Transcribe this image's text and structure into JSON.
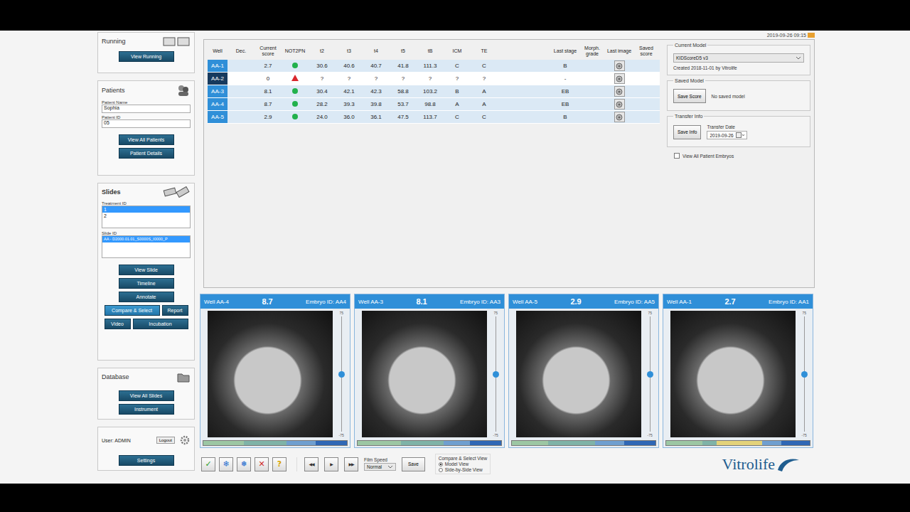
{
  "app": {
    "datetime": "2019-09-26 09:15"
  },
  "sidebar": {
    "running": {
      "title": "Running",
      "buttons": [
        {
          "label": "View Running"
        }
      ]
    },
    "patients": {
      "title": "Patients",
      "fields": [
        {
          "label": "Patient Name",
          "value": "Sophia"
        },
        {
          "label": "Patient ID",
          "value": "05"
        }
      ],
      "buttons": [
        {
          "label": "View All Patients"
        },
        {
          "label": "Patient Details"
        }
      ]
    },
    "slides": {
      "title": "Slides",
      "treatment_label": "Treatment ID",
      "treatments": [
        {
          "label": "1",
          "selected": true
        },
        {
          "label": "2",
          "selected": false
        }
      ],
      "slide_label": "Slide ID",
      "slides": [
        {
          "label": "AA - D2000.01.01_S0000S_I0000_P",
          "selected": true
        }
      ],
      "buttons": [
        {
          "label": "View Slide",
          "kind": "full",
          "selected": false
        },
        {
          "label": "Timeline",
          "kind": "full",
          "selected": false
        },
        {
          "label": "Annotate",
          "kind": "full",
          "selected": false
        },
        {
          "label": "Compare & Select",
          "kind": "full",
          "selected": true
        },
        {
          "label": "Report",
          "kind": "half",
          "selected": false
        },
        {
          "label": "Video",
          "kind": "half",
          "selected": false
        },
        {
          "label": "Incubation",
          "kind": "full",
          "selected": false
        }
      ]
    },
    "database": {
      "title": "Database",
      "buttons": [
        {
          "label": "View All Slides"
        },
        {
          "label": "Instrument"
        }
      ]
    },
    "user": {
      "label": "User: ADMIN",
      "logout": "Logout",
      "settings": "Settings"
    }
  },
  "table": {
    "columns": [
      "Well",
      "Dec.",
      "Current score",
      "NOT2PN",
      "t2",
      "t3",
      "t4",
      "t5",
      "tB",
      "ICM",
      "TE",
      "",
      "",
      "Last stage",
      "Morph. grade",
      "Last image",
      "Saved score"
    ],
    "rows": [
      {
        "well": "AA-1",
        "selected": false,
        "highlighted": true,
        "dec": "",
        "score": "2.7",
        "not2pn": {
          "kind": "dot",
          "color": "#22b14c"
        },
        "values": [
          "30.6",
          "40.6",
          "40.7",
          "41.8",
          "111.3",
          "C",
          "C",
          "",
          ""
        ],
        "last_stage": "B",
        "morph": "",
        "has_image": true,
        "saved": ""
      },
      {
        "well": "AA-2",
        "selected": true,
        "highlighted": false,
        "dec": "",
        "score": "0",
        "not2pn": {
          "kind": "triangle",
          "color": "#d9262c"
        },
        "values": [
          "?",
          "?",
          "?",
          "?",
          "?",
          "?",
          "?",
          "",
          ""
        ],
        "last_stage": "-",
        "morph": "",
        "has_image": true,
        "saved": ""
      },
      {
        "well": "AA-3",
        "selected": false,
        "highlighted": true,
        "dec": "",
        "score": "8.1",
        "not2pn": {
          "kind": "dot",
          "color": "#22b14c"
        },
        "values": [
          "30.4",
          "42.1",
          "42.3",
          "58.8",
          "103.2",
          "B",
          "A",
          "",
          ""
        ],
        "last_stage": "EB",
        "morph": "",
        "has_image": true,
        "saved": ""
      },
      {
        "well": "AA-4",
        "selected": false,
        "highlighted": true,
        "dec": "",
        "score": "8.7",
        "not2pn": {
          "kind": "dot",
          "color": "#22b14c"
        },
        "values": [
          "28.2",
          "39.3",
          "39.8",
          "53.7",
          "98.8",
          "A",
          "A",
          "",
          ""
        ],
        "last_stage": "EB",
        "morph": "",
        "has_image": true,
        "saved": ""
      },
      {
        "well": "AA-5",
        "selected": false,
        "highlighted": true,
        "dec": "",
        "score": "2.9",
        "not2pn": {
          "kind": "dot",
          "color": "#22b14c"
        },
        "values": [
          "24.0",
          "36.0",
          "36.1",
          "47.5",
          "113.7",
          "C",
          "C",
          "",
          ""
        ],
        "last_stage": "B",
        "morph": "",
        "has_image": true,
        "saved": ""
      }
    ]
  },
  "right_panel": {
    "current_model": {
      "title": "Current Model",
      "value": "KIDScoreD5 v3",
      "created": "Created 2018-11-01 by Vitrolife"
    },
    "saved_model": {
      "title": "Saved Model",
      "button": "Save Score",
      "status": "No saved model"
    },
    "transfer": {
      "title": "Transfer Info",
      "button": "Save Info",
      "date_label": "Transfer Date",
      "date": "2019-09-26"
    },
    "view_all": {
      "label": "View All Patient Embryos",
      "checked": false
    }
  },
  "cards": [
    {
      "well": "Well AA-4",
      "score": "8.7",
      "embryo": "Embryo ID: AA4",
      "focus_max": "75",
      "focus_min": "-75",
      "focus": 0.5,
      "timeline": [
        {
          "color": "#9cc7a4",
          "level": 0.28
        },
        {
          "color": "#7fb3a8",
          "level": 0.3
        },
        {
          "color": "#6f9fd0",
          "level": 0.2
        },
        {
          "color": "#2f67b5",
          "level": 0.22
        }
      ]
    },
    {
      "well": "Well AA-3",
      "score": "8.1",
      "embryo": "Embryo ID: AA3",
      "focus_max": "75",
      "focus_min": "-75",
      "focus": 0.5,
      "timeline": [
        {
          "color": "#9cc7a4",
          "level": 0.3
        },
        {
          "color": "#7fb3a8",
          "level": 0.3
        },
        {
          "color": "#6f9fd0",
          "level": 0.18
        },
        {
          "color": "#2f67b5",
          "level": 0.22
        }
      ]
    },
    {
      "well": "Well AA-5",
      "score": "2.9",
      "embryo": "Embryo ID: AA5",
      "focus_max": "75",
      "focus_min": "-75",
      "focus": 0.5,
      "timeline": [
        {
          "color": "#9cc7a4",
          "level": 0.25
        },
        {
          "color": "#7fb3a8",
          "level": 0.33
        },
        {
          "color": "#6f9fd0",
          "level": 0.2
        },
        {
          "color": "#2f67b5",
          "level": 0.22
        }
      ]
    },
    {
      "well": "Well AA-1",
      "score": "2.7",
      "embryo": "Embryo ID: AA1",
      "focus_max": "75",
      "focus_min": "-75",
      "focus": 0.5,
      "timeline": [
        {
          "color": "#9cc7a4",
          "level": 0.25
        },
        {
          "color": "#7fb3a8",
          "level": 0.1
        },
        {
          "color": "#e3d27a",
          "level": 0.32
        },
        {
          "color": "#6f9fd0",
          "level": 0.13
        },
        {
          "color": "#2f67b5",
          "level": 0.2
        }
      ]
    }
  ],
  "controls": {
    "decisions": [
      {
        "icon": "✓",
        "color": "#2a9d2a"
      },
      {
        "icon": "❄",
        "color": "#2a6fd0"
      },
      {
        "icon": "❅",
        "color": "#2a6fd0"
      },
      {
        "icon": "✕",
        "color": "#d02a2a"
      },
      {
        "icon": "?",
        "color": "#d9a400"
      }
    ],
    "transport": [
      "◀◀",
      "▶",
      "▶▶"
    ],
    "film_speed": {
      "label": "Film Speed",
      "value": "Normal"
    },
    "save": "Save",
    "view": {
      "title": "Compare & Select View",
      "options": [
        {
          "label": "Model View",
          "selected": true
        },
        {
          "label": "Side-by-Side View",
          "selected": false
        }
      ]
    },
    "logo": "Vitrolife"
  }
}
